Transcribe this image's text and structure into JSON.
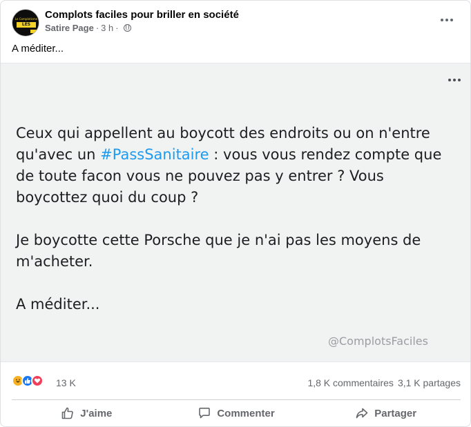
{
  "post": {
    "page_name": "Complots faciles pour briller en société",
    "page_tag": "Satire Page",
    "time": "3 h",
    "caption": "A méditer..."
  },
  "avatar": {
    "line1": "Le Complotisme",
    "line2": "LES NULS"
  },
  "image": {
    "paragraph1_before": "Ceux qui appellent au boycott des endroits ou on n'entre qu'avec un ",
    "hashtag": "#PassSanitaire",
    "paragraph1_after": " : vous vous rendez compte que de toute facon vous ne pouvez pas y entrer ? Vous boycottez quoi du coup ?",
    "paragraph2": "Je boycotte cette Porsche que je n'ai pas les moyens de m'acheter.",
    "paragraph3": "A méditer...",
    "watermark": "@ComplotsFaciles"
  },
  "stats": {
    "reactions_count": "13 K",
    "comments": "1,8 K commentaires",
    "shares": "3,1 K partages"
  },
  "actions": {
    "like": "J'aime",
    "comment": "Commenter",
    "share": "Partager"
  },
  "colors": {
    "hashtag": "#1d9bf0",
    "like": "#1877f2",
    "love": "#f33e58",
    "haha": "#f7b125"
  }
}
